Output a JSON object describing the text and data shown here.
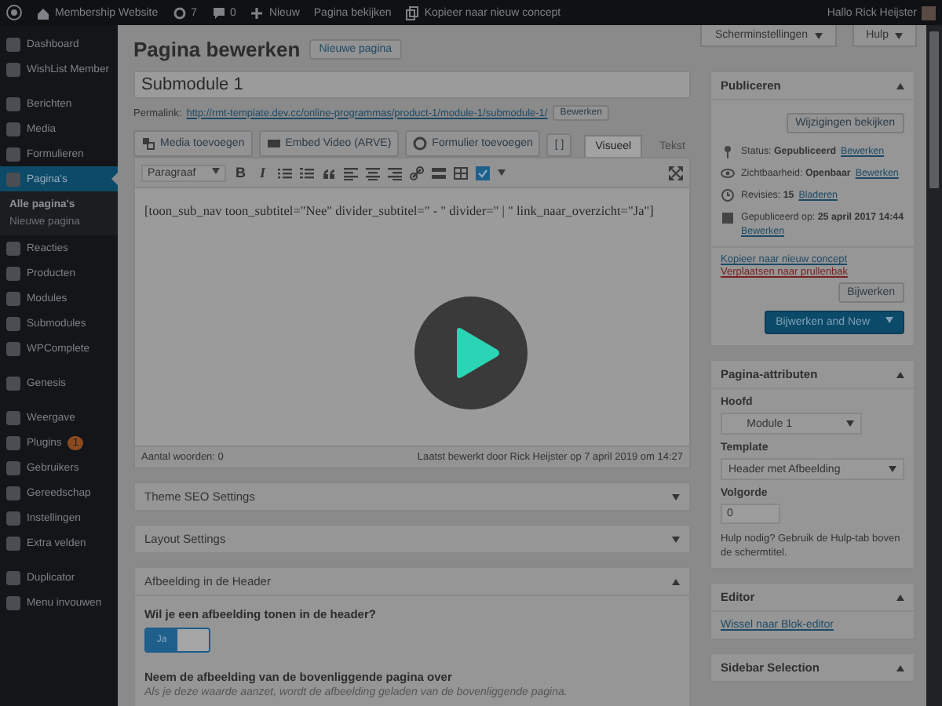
{
  "admin_bar": {
    "site": "Membership Website",
    "updates": "7",
    "comments": "0",
    "new": "Nieuw",
    "view": "Pagina bekijken",
    "copy": "Kopieer naar nieuw concept",
    "greeting": "Hallo Rick Heijster"
  },
  "sidebar": {
    "groups": [
      {
        "items": [
          {
            "label": "Dashboard",
            "selected": false
          },
          {
            "label": "WishList Member",
            "selected": false
          }
        ]
      },
      {
        "items": [
          {
            "label": "Berichten",
            "selected": false
          },
          {
            "label": "Media",
            "selected": false
          },
          {
            "label": "Formulieren",
            "selected": false
          },
          {
            "label": "Pagina's",
            "selected": true,
            "children": [
              {
                "label": "Alle pagina's",
                "selected": true
              },
              {
                "label": "Nieuwe pagina",
                "selected": false
              }
            ]
          },
          {
            "label": "Reacties",
            "selected": false
          },
          {
            "label": "Producten",
            "selected": false
          },
          {
            "label": "Modules",
            "selected": false
          },
          {
            "label": "Submodules",
            "selected": false
          },
          {
            "label": "WPComplete",
            "selected": false
          }
        ]
      },
      {
        "items": [
          {
            "label": "Genesis",
            "selected": false
          }
        ]
      },
      {
        "items": [
          {
            "label": "Weergave",
            "selected": false
          },
          {
            "label": "Plugins",
            "selected": false,
            "badge": "1"
          },
          {
            "label": "Gebruikers",
            "selected": false
          },
          {
            "label": "Gereedschap",
            "selected": false
          },
          {
            "label": "Instellingen",
            "selected": false
          },
          {
            "label": "Extra velden",
            "selected": false
          }
        ]
      },
      {
        "items": [
          {
            "label": "Duplicator",
            "selected": false
          },
          {
            "label": "Menu invouwen",
            "selected": false
          }
        ]
      }
    ]
  },
  "header": {
    "title": "Pagina bewerken",
    "new_button": "Nieuwe pagina",
    "screen_tabs": [
      "Scherminstellingen",
      "Hulp"
    ]
  },
  "post": {
    "title": "Submodule 1",
    "permalink_label": "Permalink:",
    "permalink": "http://rmt-template.dev.cc/online-programmas/product-1/module-1/submodule-1/",
    "permalink_button": "Bewerken"
  },
  "media_buttons": [
    "Media toevoegen",
    "Embed Video (ARVE)",
    "Formulier toevoegen",
    "[ ]"
  ],
  "editor_tabs": [
    {
      "label": "Visueel",
      "selected": true
    },
    {
      "label": "Tekst",
      "selected": false
    }
  ],
  "toolbar": {
    "format": "Paragraaf",
    "buttons": [
      {
        "kind": "bold",
        "label": "B"
      },
      {
        "kind": "italic",
        "label": "I"
      },
      {
        "kind": "bullet-list"
      },
      {
        "kind": "number-list"
      },
      {
        "kind": "quote"
      },
      {
        "kind": "align-left"
      },
      {
        "kind": "align-center"
      },
      {
        "kind": "align-right"
      },
      {
        "kind": "link"
      },
      {
        "kind": "more"
      },
      {
        "kind": "table"
      },
      {
        "kind": "checkbox"
      }
    ]
  },
  "editor": {
    "content": "[toon_sub_nav toon_subtitel=\"Nee\" divider_subtitel=\" - \" divider=\" | \" link_naar_overzicht=\"Ja\"]",
    "word_count": "Aantal woorden: 0",
    "last_edit": "Laatst bewerkt door Rick Heijster op 7 april 2019 om 14:27"
  },
  "boxes": [
    {
      "title": "Theme SEO Settings",
      "expanded": false
    },
    {
      "title": "Layout Settings",
      "expanded": false
    },
    {
      "title": "Afbeelding in de Header",
      "expanded": true,
      "fields": [
        {
          "kind": "toggle",
          "label": "Wil je een afbeelding tonen in de header?",
          "options": [
            {
              "label": "Ja",
              "selected": true
            },
            {
              "selected": false
            }
          ]
        },
        {
          "kind": "text",
          "label": "Neem de afbeelding van de bovenliggende pagina over",
          "description": "Als je deze waarde aanzet, wordt de afbeelding geladen van de bovenliggende pagina."
        }
      ]
    }
  ],
  "publish": {
    "title": "Publiceren",
    "expanded": true,
    "preview_button": "Wijzigingen bekijken",
    "rows": [
      {
        "kind": "status",
        "text": "Status: **Gepubliceerd**",
        "link": "Bewerken"
      },
      {
        "kind": "visibility",
        "text": "Zichtbaarheid: **Openbaar**",
        "link": "Bewerken"
      },
      {
        "kind": "revisions",
        "text": "Revisies: **15**",
        "link": "Bladeren"
      },
      {
        "kind": "date",
        "text": "Gepubliceerd op: **25 april 2017 14:44**",
        "link": "Bewerken"
      }
    ],
    "copy_link": "Kopieer naar nieuw concept",
    "trash_link": "Verplaatsen naar prullenbak",
    "update_button": "Bijwerken",
    "update_new_button": "Bijwerken and New"
  },
  "page_attributes": {
    "title": "Pagina-attributen",
    "expanded": true,
    "parent_label": "Hoofd",
    "parent": "Module 1",
    "template_label": "Template",
    "template": "Header met Afbeelding",
    "order_label": "Volgorde",
    "order": "0",
    "help": "Hulp nodig? Gebruik de Hulp-tab boven de schermtitel."
  },
  "editor_box": {
    "title": "Editor",
    "expanded": true,
    "link": "Wissel naar Blok-editor"
  },
  "sidebar_box": {
    "title": "Sidebar Selection",
    "expanded": true
  },
  "video": {
    "play": true
  }
}
